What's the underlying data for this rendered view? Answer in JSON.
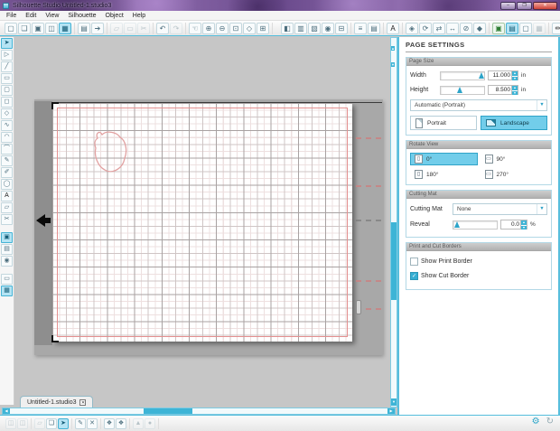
{
  "window": {
    "title": "Silhouette Studio Untitled-1.studio3",
    "controls": {
      "minimize": "–",
      "maximize": "❐",
      "close": "✕"
    }
  },
  "menu": {
    "items": [
      "File",
      "Edit",
      "View",
      "Silhouette",
      "Object",
      "Help"
    ]
  },
  "ui": {
    "check": "✓",
    "caret": "▼",
    "up": "▲",
    "down": "▼",
    "left": "◀",
    "right": "▶"
  },
  "toolbar_top": {
    "g1": [
      {
        "g": "▢",
        "n": "new-document-icon"
      },
      {
        "g": "❏",
        "n": "open-icon"
      },
      {
        "g": "▣",
        "n": "save-icon"
      },
      {
        "g": "◫",
        "n": "save-as-icon"
      },
      {
        "g": "▦",
        "n": "library-icon",
        "c": "sel"
      }
    ],
    "g2": [
      {
        "g": "▤",
        "n": "print-icon"
      },
      {
        "g": "➔",
        "n": "send-to-silhouette-icon"
      }
    ],
    "g3": [
      {
        "g": "▱",
        "n": "copy-icon",
        "c": "dim"
      },
      {
        "g": "▭",
        "n": "paste-icon",
        "c": "dim"
      },
      {
        "g": "✂",
        "n": "cut-icon",
        "c": "dim"
      }
    ],
    "g4": [
      {
        "g": "↶",
        "n": "undo-icon"
      },
      {
        "g": "↷",
        "n": "redo-icon",
        "c": "dim"
      }
    ],
    "g5": [
      {
        "g": "☜",
        "n": "pan-icon"
      },
      {
        "g": "⊕",
        "n": "zoom-in-icon"
      },
      {
        "g": "⊖",
        "n": "zoom-out-icon"
      },
      {
        "g": "⊡",
        "n": "zoom-selection-icon"
      },
      {
        "g": "◇",
        "n": "drag-zoom-icon"
      },
      {
        "g": "⊞",
        "n": "fit-to-window-icon"
      }
    ],
    "g6": [
      {
        "g": "◧",
        "n": "fill-color-icon"
      },
      {
        "g": "▥",
        "n": "line-color-icon"
      },
      {
        "g": "▧",
        "n": "line-style-icon"
      },
      {
        "g": "◉",
        "n": "opacity-icon"
      },
      {
        "g": "⊟",
        "n": "shadow-icon"
      }
    ],
    "g7": [
      {
        "g": "≡",
        "n": "align-icon"
      },
      {
        "g": "▤",
        "n": "distribute-icon"
      }
    ],
    "g8": [
      {
        "g": "A",
        "n": "text-style-icon",
        "c": "dark"
      }
    ],
    "g9": [
      {
        "g": "◈",
        "n": "transform-icon"
      },
      {
        "g": "⟳",
        "n": "rotate-icon"
      },
      {
        "g": "⇄",
        "n": "replicate-icon"
      },
      {
        "g": "↔",
        "n": "mirror-icon"
      },
      {
        "g": "⊘",
        "n": "modify-icon"
      },
      {
        "g": "◆",
        "n": "offset-icon"
      }
    ],
    "g10": [
      {
        "g": "▣",
        "n": "trace-icon",
        "c": "green"
      },
      {
        "g": "▤",
        "n": "page-settings-icon",
        "c": "sel"
      },
      {
        "g": "▢",
        "n": "grid-settings-icon"
      },
      {
        "g": "▦",
        "n": "registration-marks-icon",
        "c": "dim"
      }
    ],
    "g11": [
      {
        "g": "✏",
        "n": "cut-settings-icon",
        "c": "dark"
      },
      {
        "g": "☞",
        "n": "send-cursor-icon"
      }
    ]
  },
  "toolbar_left": {
    "tools": [
      {
        "g": "➤",
        "n": "select-tool-icon",
        "c": "sel"
      },
      {
        "g": "▷",
        "n": "edit-points-tool-icon"
      },
      {
        "g": "╱",
        "n": "line-tool-icon"
      },
      {
        "g": "▭",
        "n": "rectangle-tool-icon"
      },
      {
        "g": "▢",
        "n": "rounded-rectangle-tool-icon"
      },
      {
        "g": "◻",
        "n": "square-tool-icon"
      },
      {
        "g": "◇",
        "n": "polygon-tool-icon"
      },
      {
        "g": "∿",
        "n": "curve-tool-icon"
      },
      {
        "g": "◠",
        "n": "arc-tool-icon"
      },
      {
        "g": "⌒",
        "n": "curve-shape-tool-icon"
      },
      {
        "g": "✎",
        "n": "draw-tool-icon"
      },
      {
        "g": "✐",
        "n": "smooth-draw-tool-icon"
      },
      {
        "g": "◯",
        "n": "ellipse-tool-icon"
      },
      {
        "g": "A",
        "n": "text-tool-icon",
        "c": "dark"
      },
      {
        "g": "▱",
        "n": "note-tool-icon"
      },
      {
        "g": "✂",
        "n": "eraser-tool-icon"
      }
    ],
    "views": [
      {
        "g": "▣",
        "n": "design-view-icon",
        "c": "sel"
      },
      {
        "g": "▤",
        "n": "library-view-icon"
      },
      {
        "g": "◉",
        "n": "store-view-icon"
      }
    ],
    "extras": [
      {
        "g": "▭",
        "n": "preview-icon"
      },
      {
        "g": "▦",
        "n": "mat-preview-icon",
        "c": "sel"
      }
    ]
  },
  "toolbar_bottom": {
    "b1": [
      {
        "g": "◫",
        "n": "group-icon",
        "c": "dim"
      },
      {
        "g": "◫",
        "n": "ungroup-icon",
        "c": "dim"
      }
    ],
    "b2": [
      {
        "g": "▱",
        "n": "copy-selection-icon",
        "c": "dim"
      },
      {
        "g": "❏",
        "n": "duplicate-icon"
      },
      {
        "g": "➤",
        "n": "select-all-icon",
        "c": "sel"
      }
    ],
    "b3": [
      {
        "g": "✎",
        "n": "edit-points-icon"
      },
      {
        "g": "✕",
        "n": "delete-icon"
      }
    ],
    "b4": [
      {
        "g": "❖",
        "n": "weld-icon"
      },
      {
        "g": "❖",
        "n": "subtract-icon"
      }
    ],
    "b5": [
      {
        "g": "▲",
        "n": "bring-to-front-icon",
        "c": "dim"
      },
      {
        "g": "●",
        "n": "send-to-back-icon",
        "c": "dim"
      }
    ]
  },
  "canvas": {
    "tab": {
      "label": "Untitled-1.studio3",
      "close": "✕"
    }
  },
  "statusbar": {
    "gear": "⚙",
    "refresh": "↻"
  },
  "panel": {
    "title": "PAGE SETTINGS",
    "page_size": {
      "header": "Page Size",
      "width_label": "Width",
      "width_value": "11.000",
      "width_unit": "in",
      "height_label": "Height",
      "height_value": "8.500",
      "height_unit": "in",
      "auto_dropdown": "Automatic (Portrait)",
      "portrait": "Portrait",
      "landscape": "Landscape"
    },
    "rotate_view": {
      "header": "Rotate View",
      "options": [
        {
          "label": "0°",
          "ico": "▯",
          "c": "sel",
          "n": "rotate-0-button"
        },
        {
          "label": "90°",
          "ico": "▭",
          "n": "rotate-90-button"
        },
        {
          "label": "180°",
          "ico": "▯",
          "n": "rotate-180-button"
        },
        {
          "label": "270°",
          "ico": "▭",
          "n": "rotate-270-button"
        }
      ]
    },
    "cutting_mat": {
      "header": "Cutting Mat",
      "label": "Cutting Mat",
      "value": "None",
      "reveal_label": "Reveal",
      "reveal_value": "0.0",
      "reveal_unit": "%"
    },
    "borders": {
      "header": "Print and Cut Borders",
      "print_label": "Show Print Border",
      "cut_label": "Show Cut Border"
    }
  },
  "colors": {
    "accent": "#3db4d6",
    "selected_fill": "#72cdea",
    "cut_line": "#e49090",
    "shape_stroke": "#e2a2a2",
    "titlebar_purple": "#7a5898"
  }
}
